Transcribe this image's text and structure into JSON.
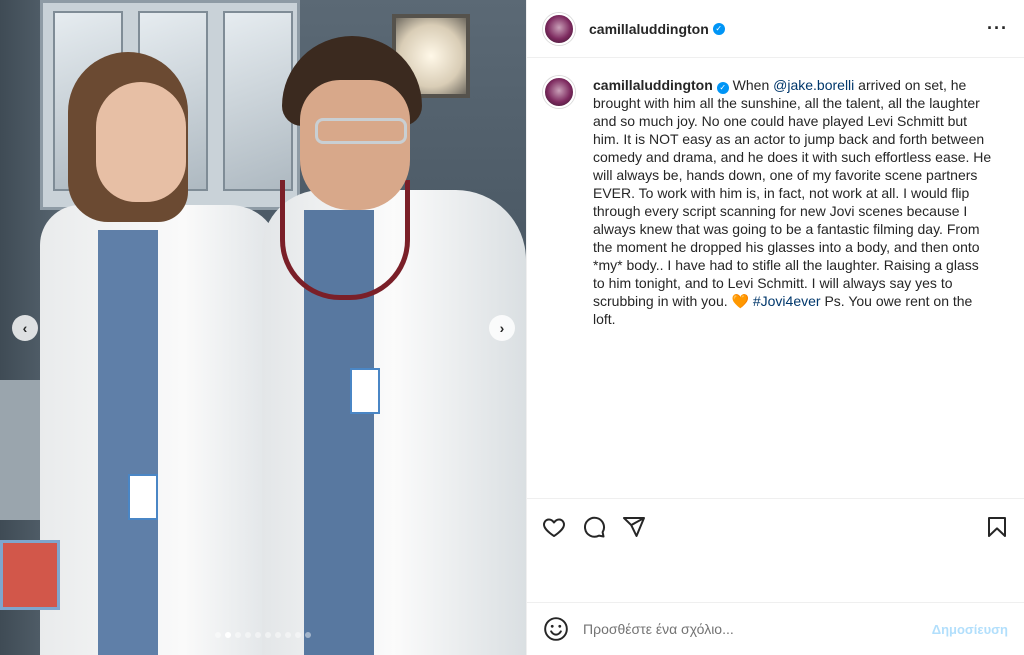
{
  "media": {
    "slide_count": 10,
    "active_slide": 2,
    "prev_icon": "chevron-left-icon",
    "next_icon": "chevron-right-icon"
  },
  "header": {
    "username": "camillaluddington",
    "verified": true,
    "more_icon": "more-horizontal-icon"
  },
  "caption": {
    "username": "camillaluddington",
    "part1": " When ",
    "mention": "@jake.borelli",
    "part2": " arrived on set, he brought with him all the sunshine, all the talent, all the laughter and so much joy. No one could have played Levi Schmitt but him. It is NOT easy as an actor to jump back and forth between comedy and drama, and he does it with such effortless ease. He will always be, hands down, one of my favorite scene partners EVER. To work with him is, in fact, not work at all. I would flip through every script scanning for new Jovi scenes because I always knew that was going to be a fantastic filming day. From the moment he dropped his glasses into a body, and then onto *my* body.. I have had to stifle all the laughter. Raising a glass to him tonight, and to Levi Schmitt. I will always say yes to scrubbing in with you. ",
    "emoji": "🧡",
    "hashtag": "#Jovi4ever",
    "part3": " Ps. You owe rent on the loft."
  },
  "actions": {
    "like_icon": "heart-icon",
    "comment_icon": "comment-icon",
    "share_icon": "paper-plane-icon",
    "save_icon": "bookmark-icon"
  },
  "comment": {
    "placeholder": "Προσθέστε ένα σχόλιο...",
    "post_label": "Δημοσίευση",
    "emoji_icon": "smiley-icon"
  },
  "colors": {
    "link": "#00376b",
    "verified": "#0095f6",
    "post_disabled": "#b2dffc"
  }
}
